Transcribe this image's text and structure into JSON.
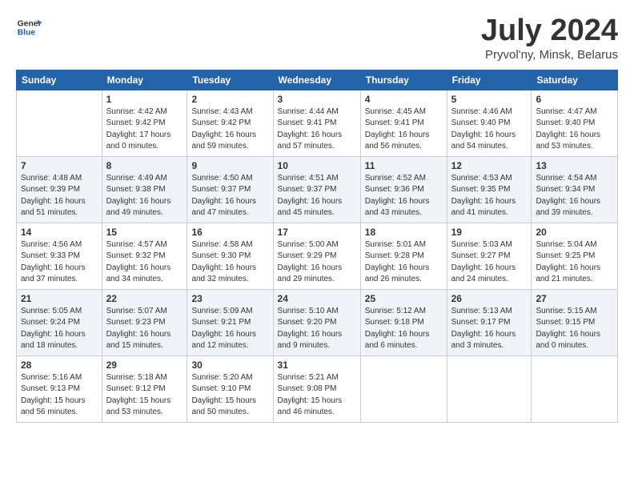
{
  "header": {
    "logo_line1": "General",
    "logo_line2": "Blue",
    "month_title": "July 2024",
    "location": "Pryvol'ny, Minsk, Belarus"
  },
  "weekdays": [
    "Sunday",
    "Monday",
    "Tuesday",
    "Wednesday",
    "Thursday",
    "Friday",
    "Saturday"
  ],
  "weeks": [
    [
      {
        "day": "",
        "info": ""
      },
      {
        "day": "1",
        "info": "Sunrise: 4:42 AM\nSunset: 9:42 PM\nDaylight: 17 hours\nand 0 minutes."
      },
      {
        "day": "2",
        "info": "Sunrise: 4:43 AM\nSunset: 9:42 PM\nDaylight: 16 hours\nand 59 minutes."
      },
      {
        "day": "3",
        "info": "Sunrise: 4:44 AM\nSunset: 9:41 PM\nDaylight: 16 hours\nand 57 minutes."
      },
      {
        "day": "4",
        "info": "Sunrise: 4:45 AM\nSunset: 9:41 PM\nDaylight: 16 hours\nand 56 minutes."
      },
      {
        "day": "5",
        "info": "Sunrise: 4:46 AM\nSunset: 9:40 PM\nDaylight: 16 hours\nand 54 minutes."
      },
      {
        "day": "6",
        "info": "Sunrise: 4:47 AM\nSunset: 9:40 PM\nDaylight: 16 hours\nand 53 minutes."
      }
    ],
    [
      {
        "day": "7",
        "info": "Sunrise: 4:48 AM\nSunset: 9:39 PM\nDaylight: 16 hours\nand 51 minutes."
      },
      {
        "day": "8",
        "info": "Sunrise: 4:49 AM\nSunset: 9:38 PM\nDaylight: 16 hours\nand 49 minutes."
      },
      {
        "day": "9",
        "info": "Sunrise: 4:50 AM\nSunset: 9:37 PM\nDaylight: 16 hours\nand 47 minutes."
      },
      {
        "day": "10",
        "info": "Sunrise: 4:51 AM\nSunset: 9:37 PM\nDaylight: 16 hours\nand 45 minutes."
      },
      {
        "day": "11",
        "info": "Sunrise: 4:52 AM\nSunset: 9:36 PM\nDaylight: 16 hours\nand 43 minutes."
      },
      {
        "day": "12",
        "info": "Sunrise: 4:53 AM\nSunset: 9:35 PM\nDaylight: 16 hours\nand 41 minutes."
      },
      {
        "day": "13",
        "info": "Sunrise: 4:54 AM\nSunset: 9:34 PM\nDaylight: 16 hours\nand 39 minutes."
      }
    ],
    [
      {
        "day": "14",
        "info": "Sunrise: 4:56 AM\nSunset: 9:33 PM\nDaylight: 16 hours\nand 37 minutes."
      },
      {
        "day": "15",
        "info": "Sunrise: 4:57 AM\nSunset: 9:32 PM\nDaylight: 16 hours\nand 34 minutes."
      },
      {
        "day": "16",
        "info": "Sunrise: 4:58 AM\nSunset: 9:30 PM\nDaylight: 16 hours\nand 32 minutes."
      },
      {
        "day": "17",
        "info": "Sunrise: 5:00 AM\nSunset: 9:29 PM\nDaylight: 16 hours\nand 29 minutes."
      },
      {
        "day": "18",
        "info": "Sunrise: 5:01 AM\nSunset: 9:28 PM\nDaylight: 16 hours\nand 26 minutes."
      },
      {
        "day": "19",
        "info": "Sunrise: 5:03 AM\nSunset: 9:27 PM\nDaylight: 16 hours\nand 24 minutes."
      },
      {
        "day": "20",
        "info": "Sunrise: 5:04 AM\nSunset: 9:25 PM\nDaylight: 16 hours\nand 21 minutes."
      }
    ],
    [
      {
        "day": "21",
        "info": "Sunrise: 5:05 AM\nSunset: 9:24 PM\nDaylight: 16 hours\nand 18 minutes."
      },
      {
        "day": "22",
        "info": "Sunrise: 5:07 AM\nSunset: 9:23 PM\nDaylight: 16 hours\nand 15 minutes."
      },
      {
        "day": "23",
        "info": "Sunrise: 5:09 AM\nSunset: 9:21 PM\nDaylight: 16 hours\nand 12 minutes."
      },
      {
        "day": "24",
        "info": "Sunrise: 5:10 AM\nSunset: 9:20 PM\nDaylight: 16 hours\nand 9 minutes."
      },
      {
        "day": "25",
        "info": "Sunrise: 5:12 AM\nSunset: 9:18 PM\nDaylight: 16 hours\nand 6 minutes."
      },
      {
        "day": "26",
        "info": "Sunrise: 5:13 AM\nSunset: 9:17 PM\nDaylight: 16 hours\nand 3 minutes."
      },
      {
        "day": "27",
        "info": "Sunrise: 5:15 AM\nSunset: 9:15 PM\nDaylight: 16 hours\nand 0 minutes."
      }
    ],
    [
      {
        "day": "28",
        "info": "Sunrise: 5:16 AM\nSunset: 9:13 PM\nDaylight: 15 hours\nand 56 minutes."
      },
      {
        "day": "29",
        "info": "Sunrise: 5:18 AM\nSunset: 9:12 PM\nDaylight: 15 hours\nand 53 minutes."
      },
      {
        "day": "30",
        "info": "Sunrise: 5:20 AM\nSunset: 9:10 PM\nDaylight: 15 hours\nand 50 minutes."
      },
      {
        "day": "31",
        "info": "Sunrise: 5:21 AM\nSunset: 9:08 PM\nDaylight: 15 hours\nand 46 minutes."
      },
      {
        "day": "",
        "info": ""
      },
      {
        "day": "",
        "info": ""
      },
      {
        "day": "",
        "info": ""
      }
    ]
  ]
}
